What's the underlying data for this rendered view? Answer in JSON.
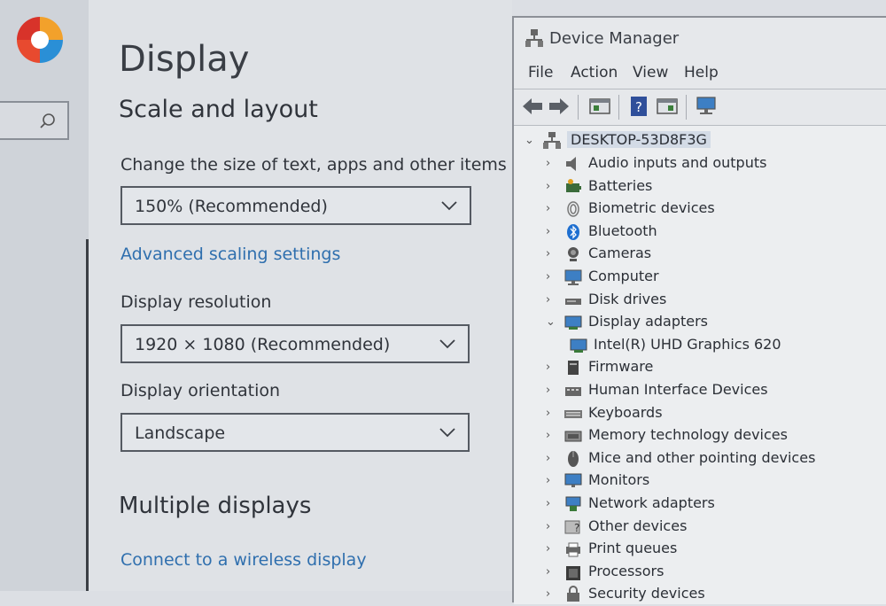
{
  "settings": {
    "title": "Display",
    "scale_heading": "Scale and layout",
    "scale_label": "Change the size of text, apps and other items",
    "scale_value": "150% (Recommended)",
    "advanced_link": "Advanced scaling settings",
    "resolution_label": "Display resolution",
    "resolution_value": "1920 × 1080 (Recommended)",
    "orientation_label": "Display orientation",
    "orientation_value": "Landscape",
    "multiple_heading": "Multiple displays",
    "wireless_link": "Connect to a wireless display"
  },
  "device_manager": {
    "title": "Device Manager",
    "menu": [
      "File",
      "Action",
      "View",
      "Help"
    ],
    "toolbar_icons": [
      "back-icon",
      "forward-icon",
      "properties-icon",
      "help-icon",
      "update-driver-icon",
      "scan-hardware-icon"
    ],
    "root": "DESKTOP-53D8F3G",
    "tree": [
      {
        "label": "Audio inputs and outputs",
        "icon": "speaker-icon",
        "expanded": false
      },
      {
        "label": "Batteries",
        "icon": "battery-icon",
        "expanded": false
      },
      {
        "label": "Biometric devices",
        "icon": "fingerprint-icon",
        "expanded": false
      },
      {
        "label": "Bluetooth",
        "icon": "bluetooth-icon",
        "expanded": false
      },
      {
        "label": "Cameras",
        "icon": "camera-icon",
        "expanded": false
      },
      {
        "label": "Computer",
        "icon": "computer-icon",
        "expanded": false
      },
      {
        "label": "Disk drives",
        "icon": "disk-icon",
        "expanded": false
      },
      {
        "label": "Display adapters",
        "icon": "display-adapter-icon",
        "expanded": true
      },
      {
        "label": "Intel(R) UHD Graphics 620",
        "icon": "display-adapter-icon",
        "child": true
      },
      {
        "label": "Firmware",
        "icon": "firmware-icon",
        "expanded": false
      },
      {
        "label": "Human Interface Devices",
        "icon": "hid-icon",
        "expanded": false
      },
      {
        "label": "Keyboards",
        "icon": "keyboard-icon",
        "expanded": false
      },
      {
        "label": "Memory technology devices",
        "icon": "memory-icon",
        "expanded": false
      },
      {
        "label": "Mice and other pointing devices",
        "icon": "mouse-icon",
        "expanded": false
      },
      {
        "label": "Monitors",
        "icon": "monitor-icon",
        "expanded": false
      },
      {
        "label": "Network adapters",
        "icon": "network-icon",
        "expanded": false
      },
      {
        "label": "Other devices",
        "icon": "unknown-device-icon",
        "expanded": false
      },
      {
        "label": "Print queues",
        "icon": "printer-icon",
        "expanded": false
      },
      {
        "label": "Processors",
        "icon": "processor-icon",
        "expanded": false
      },
      {
        "label": "Security devices",
        "icon": "security-icon",
        "expanded": false
      }
    ]
  },
  "colors": {
    "link": "#2f6fae",
    "pane_bg": "#dfe2e6",
    "dm_bg": "#eceef0",
    "root_highlight": "#d3dbe6"
  }
}
